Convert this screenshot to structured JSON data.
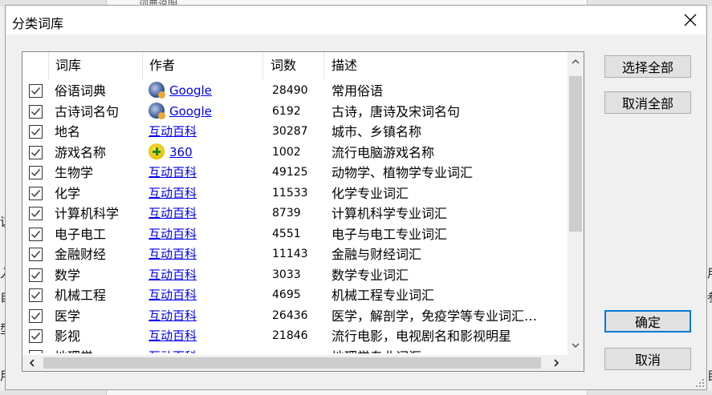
{
  "background": {
    "top_fragment": "词典说明",
    "left_fragments": [
      "议",
      "入",
      "自",
      "型",
      "用"
    ],
    "right_fragments": [
      "用",
      "参",
      "目"
    ]
  },
  "dialog": {
    "title": "分类词库",
    "close_glyph": "✕"
  },
  "table": {
    "headers": {
      "name": "词库",
      "author": "作者",
      "count": "词数",
      "desc": "描述"
    },
    "rows": [
      {
        "checked": true,
        "name": "俗语词典",
        "author": "Google",
        "author_icon": "google-icon",
        "count": "28490",
        "desc": "常用俗语"
      },
      {
        "checked": true,
        "name": "古诗词名句",
        "author": "Google",
        "author_icon": "google-icon",
        "count": "6192",
        "desc": "古诗，唐诗及宋词名句"
      },
      {
        "checked": true,
        "name": "地名",
        "author": "互动百科",
        "author_icon": "",
        "count": "30287",
        "desc": "城市、乡镇名称"
      },
      {
        "checked": true,
        "name": "游戏名称",
        "author": "360",
        "author_icon": "360-icon",
        "count": "1002",
        "desc": "流行电脑游戏名称"
      },
      {
        "checked": true,
        "name": "生物学",
        "author": "互动百科",
        "author_icon": "",
        "count": "49125",
        "desc": "动物学、植物学专业词汇"
      },
      {
        "checked": true,
        "name": "化学",
        "author": "互动百科",
        "author_icon": "",
        "count": "11533",
        "desc": "化学专业词汇"
      },
      {
        "checked": true,
        "name": "计算机科学",
        "author": "互动百科",
        "author_icon": "",
        "count": "8739",
        "desc": "计算机科学专业词汇"
      },
      {
        "checked": true,
        "name": "电子电工",
        "author": "互动百科",
        "author_icon": "",
        "count": "4551",
        "desc": "电子与电工专业词汇"
      },
      {
        "checked": true,
        "name": "金融财经",
        "author": "互动百科",
        "author_icon": "",
        "count": "11143",
        "desc": "金融与财经词汇"
      },
      {
        "checked": true,
        "name": "数学",
        "author": "互动百科",
        "author_icon": "",
        "count": "3033",
        "desc": "数学专业词汇"
      },
      {
        "checked": true,
        "name": "机械工程",
        "author": "互动百科",
        "author_icon": "",
        "count": "4695",
        "desc": "机械工程专业词汇"
      },
      {
        "checked": true,
        "name": "医学",
        "author": "互动百科",
        "author_icon": "",
        "count": "26436",
        "desc": "医学，解剖学，免疫学等专业词汇…"
      },
      {
        "checked": true,
        "name": "影视",
        "author": "互动百科",
        "author_icon": "",
        "count": "21846",
        "desc": "流行电影，电视剧名和影视明星"
      },
      {
        "checked": true,
        "name": "地理学",
        "author": "互动百科",
        "author_icon": "",
        "count": "",
        "desc": "地理学专业词汇"
      }
    ]
  },
  "buttons": {
    "select_all": "选择全部",
    "deselect_all": "取消全部",
    "ok": "确定",
    "cancel": "取消"
  },
  "colors": {
    "link": "#0000ee",
    "default_button_border": "#0078d7"
  }
}
